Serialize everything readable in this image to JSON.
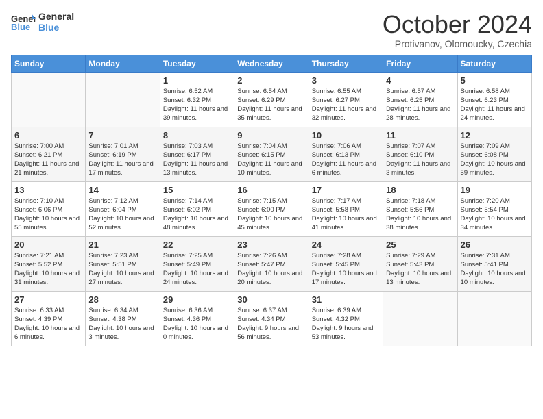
{
  "header": {
    "logo_line1": "General",
    "logo_line2": "Blue",
    "month": "October 2024",
    "location": "Protivanov, Olomoucky, Czechia"
  },
  "days_of_week": [
    "Sunday",
    "Monday",
    "Tuesday",
    "Wednesday",
    "Thursday",
    "Friday",
    "Saturday"
  ],
  "weeks": [
    [
      {
        "num": "",
        "info": ""
      },
      {
        "num": "",
        "info": ""
      },
      {
        "num": "1",
        "info": "Sunrise: 6:52 AM\nSunset: 6:32 PM\nDaylight: 11 hours and 39 minutes."
      },
      {
        "num": "2",
        "info": "Sunrise: 6:54 AM\nSunset: 6:29 PM\nDaylight: 11 hours and 35 minutes."
      },
      {
        "num": "3",
        "info": "Sunrise: 6:55 AM\nSunset: 6:27 PM\nDaylight: 11 hours and 32 minutes."
      },
      {
        "num": "4",
        "info": "Sunrise: 6:57 AM\nSunset: 6:25 PM\nDaylight: 11 hours and 28 minutes."
      },
      {
        "num": "5",
        "info": "Sunrise: 6:58 AM\nSunset: 6:23 PM\nDaylight: 11 hours and 24 minutes."
      }
    ],
    [
      {
        "num": "6",
        "info": "Sunrise: 7:00 AM\nSunset: 6:21 PM\nDaylight: 11 hours and 21 minutes."
      },
      {
        "num": "7",
        "info": "Sunrise: 7:01 AM\nSunset: 6:19 PM\nDaylight: 11 hours and 17 minutes."
      },
      {
        "num": "8",
        "info": "Sunrise: 7:03 AM\nSunset: 6:17 PM\nDaylight: 11 hours and 13 minutes."
      },
      {
        "num": "9",
        "info": "Sunrise: 7:04 AM\nSunset: 6:15 PM\nDaylight: 11 hours and 10 minutes."
      },
      {
        "num": "10",
        "info": "Sunrise: 7:06 AM\nSunset: 6:13 PM\nDaylight: 11 hours and 6 minutes."
      },
      {
        "num": "11",
        "info": "Sunrise: 7:07 AM\nSunset: 6:10 PM\nDaylight: 11 hours and 3 minutes."
      },
      {
        "num": "12",
        "info": "Sunrise: 7:09 AM\nSunset: 6:08 PM\nDaylight: 10 hours and 59 minutes."
      }
    ],
    [
      {
        "num": "13",
        "info": "Sunrise: 7:10 AM\nSunset: 6:06 PM\nDaylight: 10 hours and 55 minutes."
      },
      {
        "num": "14",
        "info": "Sunrise: 7:12 AM\nSunset: 6:04 PM\nDaylight: 10 hours and 52 minutes."
      },
      {
        "num": "15",
        "info": "Sunrise: 7:14 AM\nSunset: 6:02 PM\nDaylight: 10 hours and 48 minutes."
      },
      {
        "num": "16",
        "info": "Sunrise: 7:15 AM\nSunset: 6:00 PM\nDaylight: 10 hours and 45 minutes."
      },
      {
        "num": "17",
        "info": "Sunrise: 7:17 AM\nSunset: 5:58 PM\nDaylight: 10 hours and 41 minutes."
      },
      {
        "num": "18",
        "info": "Sunrise: 7:18 AM\nSunset: 5:56 PM\nDaylight: 10 hours and 38 minutes."
      },
      {
        "num": "19",
        "info": "Sunrise: 7:20 AM\nSunset: 5:54 PM\nDaylight: 10 hours and 34 minutes."
      }
    ],
    [
      {
        "num": "20",
        "info": "Sunrise: 7:21 AM\nSunset: 5:52 PM\nDaylight: 10 hours and 31 minutes."
      },
      {
        "num": "21",
        "info": "Sunrise: 7:23 AM\nSunset: 5:51 PM\nDaylight: 10 hours and 27 minutes."
      },
      {
        "num": "22",
        "info": "Sunrise: 7:25 AM\nSunset: 5:49 PM\nDaylight: 10 hours and 24 minutes."
      },
      {
        "num": "23",
        "info": "Sunrise: 7:26 AM\nSunset: 5:47 PM\nDaylight: 10 hours and 20 minutes."
      },
      {
        "num": "24",
        "info": "Sunrise: 7:28 AM\nSunset: 5:45 PM\nDaylight: 10 hours and 17 minutes."
      },
      {
        "num": "25",
        "info": "Sunrise: 7:29 AM\nSunset: 5:43 PM\nDaylight: 10 hours and 13 minutes."
      },
      {
        "num": "26",
        "info": "Sunrise: 7:31 AM\nSunset: 5:41 PM\nDaylight: 10 hours and 10 minutes."
      }
    ],
    [
      {
        "num": "27",
        "info": "Sunrise: 6:33 AM\nSunset: 4:39 PM\nDaylight: 10 hours and 6 minutes."
      },
      {
        "num": "28",
        "info": "Sunrise: 6:34 AM\nSunset: 4:38 PM\nDaylight: 10 hours and 3 minutes."
      },
      {
        "num": "29",
        "info": "Sunrise: 6:36 AM\nSunset: 4:36 PM\nDaylight: 10 hours and 0 minutes."
      },
      {
        "num": "30",
        "info": "Sunrise: 6:37 AM\nSunset: 4:34 PM\nDaylight: 9 hours and 56 minutes."
      },
      {
        "num": "31",
        "info": "Sunrise: 6:39 AM\nSunset: 4:32 PM\nDaylight: 9 hours and 53 minutes."
      },
      {
        "num": "",
        "info": ""
      },
      {
        "num": "",
        "info": ""
      }
    ]
  ]
}
